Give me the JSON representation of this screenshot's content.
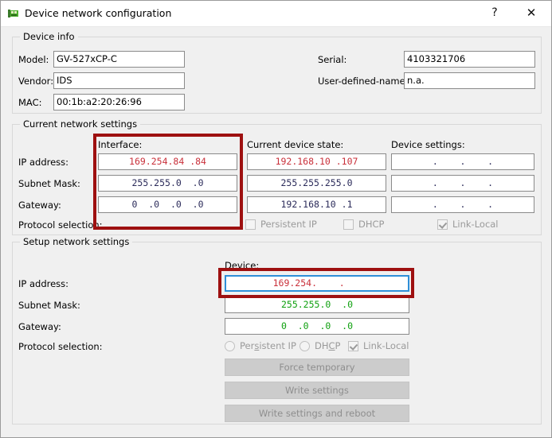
{
  "window": {
    "title": "Device network configuration",
    "icon": "network-card-icon",
    "help_label": "?",
    "close_label": "✕"
  },
  "device_info": {
    "legend": "Device info",
    "fields": [
      {
        "label": "Model:",
        "value": "GV-527xCP-C"
      },
      {
        "label": "Vendor:",
        "value": "IDS"
      },
      {
        "label": "MAC:",
        "value": "00:1b:a2:20:26:96"
      }
    ],
    "right_fields": [
      {
        "label": "Serial:",
        "value": "4103321706"
      },
      {
        "label": "User-defined-name:",
        "value": "n.a."
      }
    ]
  },
  "current_network": {
    "legend": "Current network settings",
    "row_labels": [
      "IP address:",
      "Subnet Mask:",
      "Gateway:",
      "Protocol selection:"
    ],
    "columns": [
      {
        "header": "Interface:",
        "values": [
          "169.254.84 .84",
          "255.255.0  .0",
          "0  .0  .0  .0"
        ],
        "colors": [
          "red",
          "dark",
          "dark"
        ]
      },
      {
        "header": "Current device state:",
        "values": [
          "192.168.10 .107",
          "255.255.255.0",
          "192.168.10 .1"
        ],
        "colors": [
          "red",
          "dark",
          "dark"
        ]
      },
      {
        "header": "Device settings:",
        "values": [
          "  .    .    .  ",
          "  .    .    .  ",
          "  .    .    .  "
        ],
        "colors": [
          "none",
          "none",
          "none"
        ]
      }
    ],
    "protocols": [
      {
        "label": "Persistent IP",
        "type": "checkbox",
        "checked": false
      },
      {
        "label": "DHCP",
        "type": "checkbox",
        "checked": false
      },
      {
        "label": "Link-Local",
        "type": "checkbox",
        "checked": true
      }
    ]
  },
  "setup_network": {
    "legend": "Setup network settings",
    "column_header": "Device:",
    "row_labels": [
      "IP address:",
      "Subnet Mask:",
      "Gateway:",
      "Protocol selection:"
    ],
    "values": [
      "169.254.    .   ",
      "255.255.0  .0",
      "0  .0  .0  .0"
    ],
    "colors": [
      "red",
      "green",
      "green"
    ],
    "focused_row": 0,
    "protocols": [
      {
        "label_pre": "Per",
        "label_mn": "s",
        "label_post": "istent IP",
        "type": "radio",
        "checked": false
      },
      {
        "label_pre": "DH",
        "label_mn": "C",
        "label_post": "P",
        "type": "radio",
        "checked": false
      },
      {
        "label_pre": "",
        "label_mn": "",
        "label_post": "Link-Local",
        "type": "checkbox",
        "checked": true
      }
    ],
    "buttons": [
      "Force temporary",
      "Write settings",
      "Write settings and reboot"
    ]
  },
  "annotations": {
    "accent_color": "#9e1010",
    "focus_color": "#2f8fd8",
    "boxes": [
      "interface-column-highlight",
      "setup-ip-address-highlight"
    ]
  }
}
